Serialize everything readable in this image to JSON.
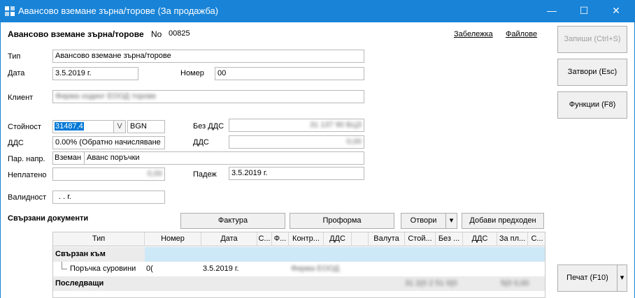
{
  "window": {
    "title": "Авансово вземане зърна/торове (За продажба)",
    "minimize": "—",
    "maximize": "☐",
    "close": "✕"
  },
  "header": {
    "doc_title": "Авансово вземане зърна/торове",
    "no_label": "No",
    "no_value": "00825",
    "note_link": "Забележка",
    "files_link": "Файлове"
  },
  "form": {
    "type_label": "Тип",
    "type_value": "Авансово вземане зърна/торове",
    "date_label": "Дата",
    "date_value": "3.5.2019 г.",
    "number_label": "Номер",
    "number_value": "00",
    "client_label": "Клиент",
    "client_value": "Фирма ходинг ЕООД торове",
    "value_label": "Стойност",
    "value_value": "31487,4",
    "value_v": "V",
    "currency": "BGN",
    "novat_label": "Без ДДС",
    "novat_value": "31 137 90 БЦЗ",
    "vat_label": "ДДС",
    "vat_value": "0.00% (Обратно начисляване",
    "vat2_label": "ДДС",
    "vat2_value": "0,00",
    "par_label": "Пар. напр.",
    "par_value1": "Вземан",
    "par_value2": "Аванс поръчки",
    "unpaid_label": "Неплатено",
    "unpaid_value": "0,00",
    "due_label": "Падеж",
    "due_value": "3.5.2019 г.",
    "valid_label": "Валидност",
    "valid_value": ".  .    г."
  },
  "linked": {
    "title": "Свързани документи",
    "invoice_btn": "Фактура",
    "proforma_btn": "Проформа",
    "open_btn": "Отвори",
    "open_arrow": "▾",
    "add_prev_btn": "Добави предходен"
  },
  "grid": {
    "columns": [
      "Тип",
      "Номер",
      "Дата",
      "С...",
      "Ф...",
      "Контр...",
      "ДДС",
      "",
      "Валута",
      "Стой...",
      "Без ...",
      "ДДС",
      "За пл...",
      "С..."
    ],
    "group1": "Свързан към",
    "row1_type": "Поръчка суровини",
    "row1_num": "0(",
    "row1_date": "3.5.2019 г.",
    "row1_blur": "Фирма ЕООД",
    "group2": "Последващи",
    "group2_blur": "31 2(0 2 51 0(0",
    "group2_blur2": "5(0 0,00"
  },
  "buttons": {
    "save": "Запиши (Ctrl+S)",
    "close": "Затвори (Esc)",
    "functions": "Функции (F8)",
    "print": "Печат (F10)",
    "print_arrow": "▾"
  },
  "colors": {
    "titlebar": "#1883d7",
    "selection": "#0078d7",
    "group_highlight": "#cde8f7"
  }
}
